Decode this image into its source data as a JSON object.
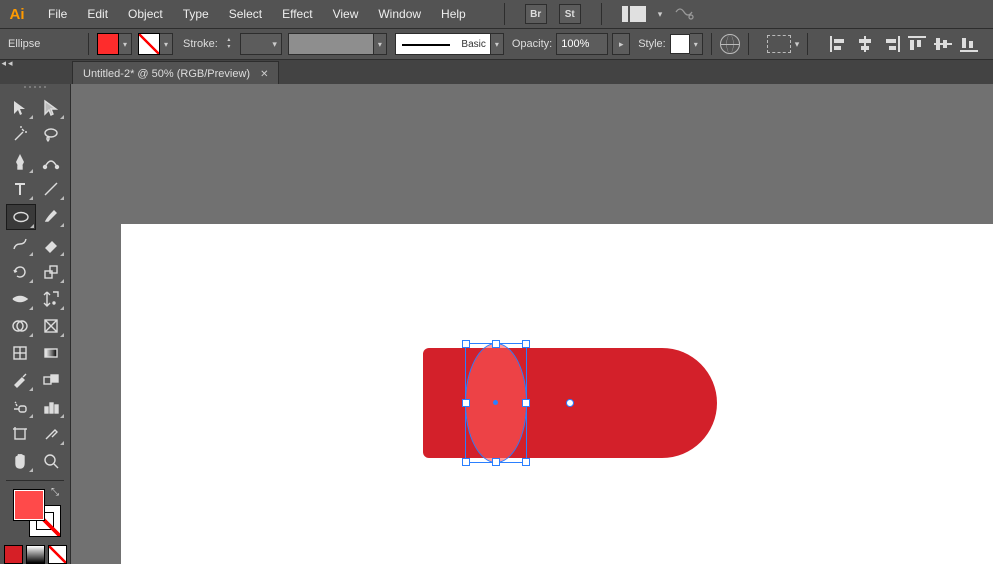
{
  "menubar": {
    "logo": "Ai",
    "items": [
      "File",
      "Edit",
      "Object",
      "Type",
      "Select",
      "Effect",
      "View",
      "Window",
      "Help"
    ],
    "bridge": "Br",
    "stock": "St"
  },
  "controlbar": {
    "shape_label": "Ellipse",
    "stroke_label": "Stroke:",
    "stroke_weight": "",
    "brush_label": "Basic",
    "opacity_label": "Opacity:",
    "opacity_value": "100%",
    "style_label": "Style:"
  },
  "documents": {
    "active_tab": "Untitled-2* @ 50% (RGB/Preview)"
  },
  "tools": {
    "rows": [
      [
        "selection",
        "direct-selection"
      ],
      [
        "magic-wand",
        "lasso"
      ],
      [
        "pen",
        "curvature"
      ],
      [
        "type",
        "line-segment"
      ],
      [
        "ellipse",
        "paintbrush"
      ],
      [
        "pencil",
        "eraser"
      ],
      [
        "rotate",
        "scale"
      ],
      [
        "width",
        "free-transform"
      ],
      [
        "shape-builder",
        "perspective-grid"
      ],
      [
        "mesh",
        "gradient"
      ],
      [
        "eyedropper",
        "blend"
      ],
      [
        "symbol-sprayer",
        "column-graph"
      ],
      [
        "artboard",
        "slice"
      ],
      [
        "hand",
        "zoom"
      ]
    ],
    "selected": "ellipse"
  },
  "fillstroke": {
    "fill": "#ff4a4a",
    "stroke": "none"
  },
  "canvas": {
    "shape_fill": "#d3202a",
    "selected_object": "ellipse"
  }
}
